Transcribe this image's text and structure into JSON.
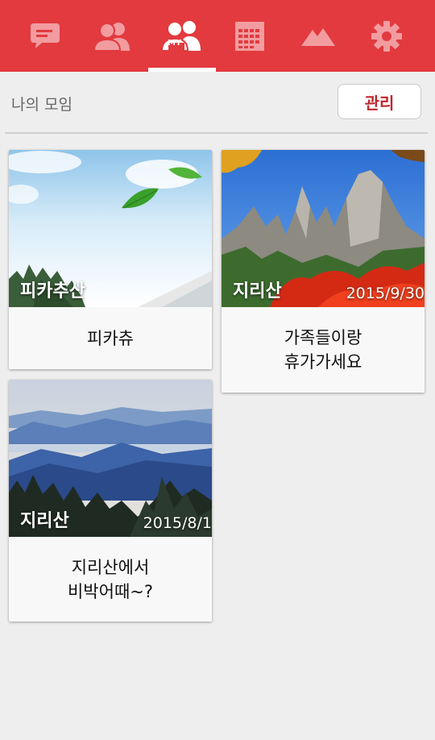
{
  "nav": {
    "tabs": [
      {
        "name": "chat",
        "icon": "chat-bubble-icon"
      },
      {
        "name": "friends",
        "icon": "people-icon"
      },
      {
        "name": "my-groups",
        "icon": "my-group-icon",
        "badge": "MY",
        "active": true
      },
      {
        "name": "calendar",
        "icon": "calendar-icon"
      },
      {
        "name": "mountain",
        "icon": "mountain-icon"
      },
      {
        "name": "settings",
        "icon": "gear-icon"
      }
    ],
    "colors": {
      "bar": "#e23a3f",
      "icon_inactive": "#f29ca0",
      "icon_active": "#ffffff"
    }
  },
  "section": {
    "title": "나의 모임",
    "manage_label": "관리"
  },
  "groups": [
    {
      "photo_label": "피카추산",
      "date": "",
      "title": "피카츄"
    },
    {
      "photo_label": "지리산",
      "date": "2015/9/30",
      "title": "가족들이랑\n휴가가세요"
    },
    {
      "photo_label": "지리산",
      "date": "2015/8/1",
      "title": "지리산에서\n비박어때~?"
    }
  ],
  "accent": "#c0262d"
}
